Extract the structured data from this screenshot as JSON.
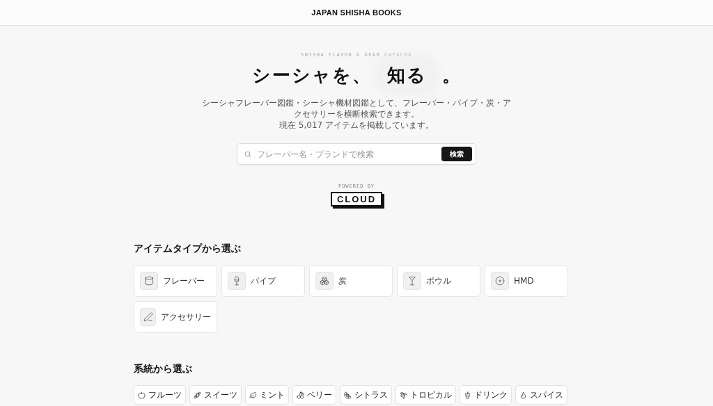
{
  "header": {
    "title": "JAPAN SHISHA BOOKS"
  },
  "hero": {
    "eyebrow": "SHISHA FLAVOR & GEAR CATALOG",
    "title_before": "シーシャを、",
    "title_highlight": "知る",
    "title_after": "。",
    "description": "シーシャフレーバー図鑑・シーシャ機材図鑑として、フレーバー・パイプ・炭・アクセサリーを横断検索できます。",
    "count_line": "現在 5,017 アイテムを掲載しています。"
  },
  "search": {
    "placeholder": "フレーバー名・ブランドで検索",
    "button": "検索"
  },
  "powered": {
    "label": "POWERED BY",
    "logo": "CLOUD"
  },
  "item_types": {
    "heading": "アイテムタイプから選ぶ",
    "items": [
      {
        "label": "フレーバー"
      },
      {
        "label": "パイプ"
      },
      {
        "label": "炭"
      },
      {
        "label": "ボウル"
      },
      {
        "label": "HMD"
      },
      {
        "label": "アクセサリー"
      }
    ]
  },
  "families": {
    "heading": "系統から選ぶ",
    "items": [
      {
        "label": "フルーツ"
      },
      {
        "label": "スイーツ"
      },
      {
        "label": "ミント"
      },
      {
        "label": "ベリー"
      },
      {
        "label": "シトラス"
      },
      {
        "label": "トロピカル"
      },
      {
        "label": "ドリンク"
      },
      {
        "label": "スパイス"
      }
    ]
  }
}
